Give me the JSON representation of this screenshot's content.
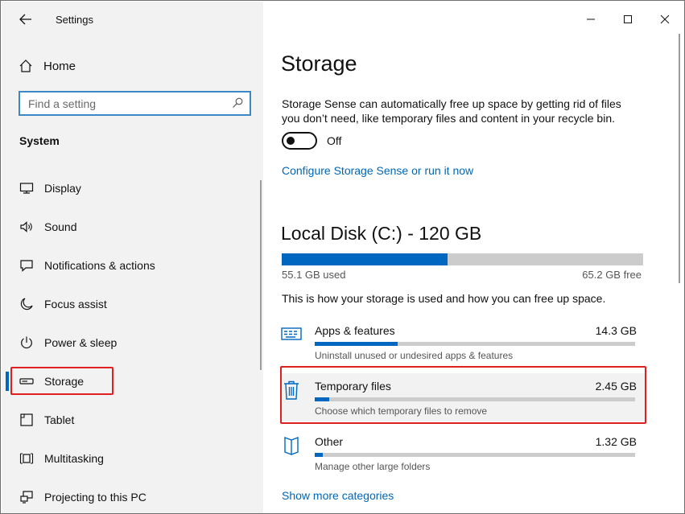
{
  "window": {
    "title": "Settings",
    "minimize_icon": "minimize-icon",
    "maximize_icon": "maximize-icon",
    "close_icon": "close-icon"
  },
  "sidebar": {
    "home_label": "Home",
    "search_placeholder": "Find a setting",
    "section_label": "System",
    "items": [
      {
        "label": "Display",
        "icon": "monitor-icon"
      },
      {
        "label": "Sound",
        "icon": "speaker-icon"
      },
      {
        "label": "Notifications & actions",
        "icon": "notification-icon"
      },
      {
        "label": "Focus assist",
        "icon": "moon-icon"
      },
      {
        "label": "Power & sleep",
        "icon": "power-icon"
      },
      {
        "label": "Storage",
        "icon": "storage-drive-icon",
        "active": true
      },
      {
        "label": "Tablet",
        "icon": "tablet-icon"
      },
      {
        "label": "Multitasking",
        "icon": "multitasking-icon"
      },
      {
        "label": "Projecting to this PC",
        "icon": "projecting-icon"
      }
    ]
  },
  "main": {
    "title": "Storage",
    "description": "Storage Sense can automatically free up space by getting rid of files you don’t need, like temporary files and content in your recycle bin.",
    "toggle_state": "Off",
    "configure_link": "Configure Storage Sense or run it now",
    "disk": {
      "title": "Local Disk (C:) - 120 GB",
      "used": "55.1 GB used",
      "free": "65.2 GB free",
      "used_fraction": 0.459
    },
    "usage_description": "This is how your storage is used and how you can free up space.",
    "categories": [
      {
        "name": "Apps & features",
        "size": "14.3 GB",
        "subtitle": "Uninstall unused or undesired apps & features",
        "fraction": 0.26,
        "icon": "apps-icon"
      },
      {
        "name": "Temporary files",
        "size": "2.45 GB",
        "subtitle": "Choose which temporary files to remove",
        "fraction": 0.045,
        "icon": "trash-icon"
      },
      {
        "name": "Other",
        "size": "1.32 GB",
        "subtitle": "Manage other large folders",
        "fraction": 0.025,
        "icon": "document-icon"
      }
    ],
    "show_more_link": "Show more categories"
  },
  "colors": {
    "accent": "#0067c0",
    "highlight_border": "#e02020",
    "link": "#0067b8"
  }
}
